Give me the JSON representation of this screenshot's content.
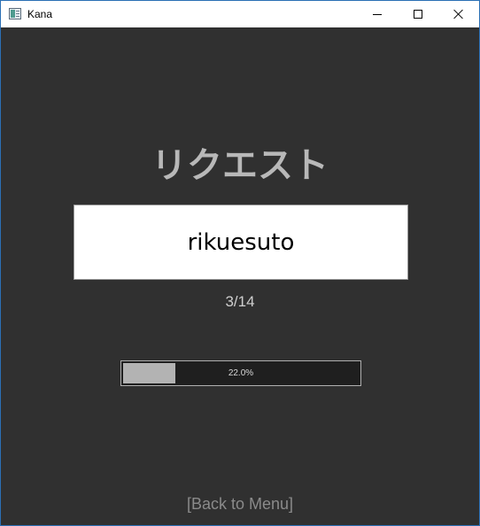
{
  "window": {
    "title": "Kana",
    "icon": "app-window-icon",
    "controls": {
      "minimize_icon": "minimize-icon",
      "maximize_icon": "maximize-icon",
      "close_icon": "close-icon"
    }
  },
  "quiz": {
    "kana": "リクエスト",
    "answer": "rikuesuto",
    "counter": "3/14",
    "progress": {
      "fraction": 0.22,
      "label": "22.0%"
    }
  },
  "footer": {
    "back_label": "[Back to Menu]"
  },
  "colors": {
    "background": "#303030",
    "kana_text": "#b8b8b8",
    "progress_fill": "#b3b3b3",
    "link_text": "#8a8a8a"
  }
}
